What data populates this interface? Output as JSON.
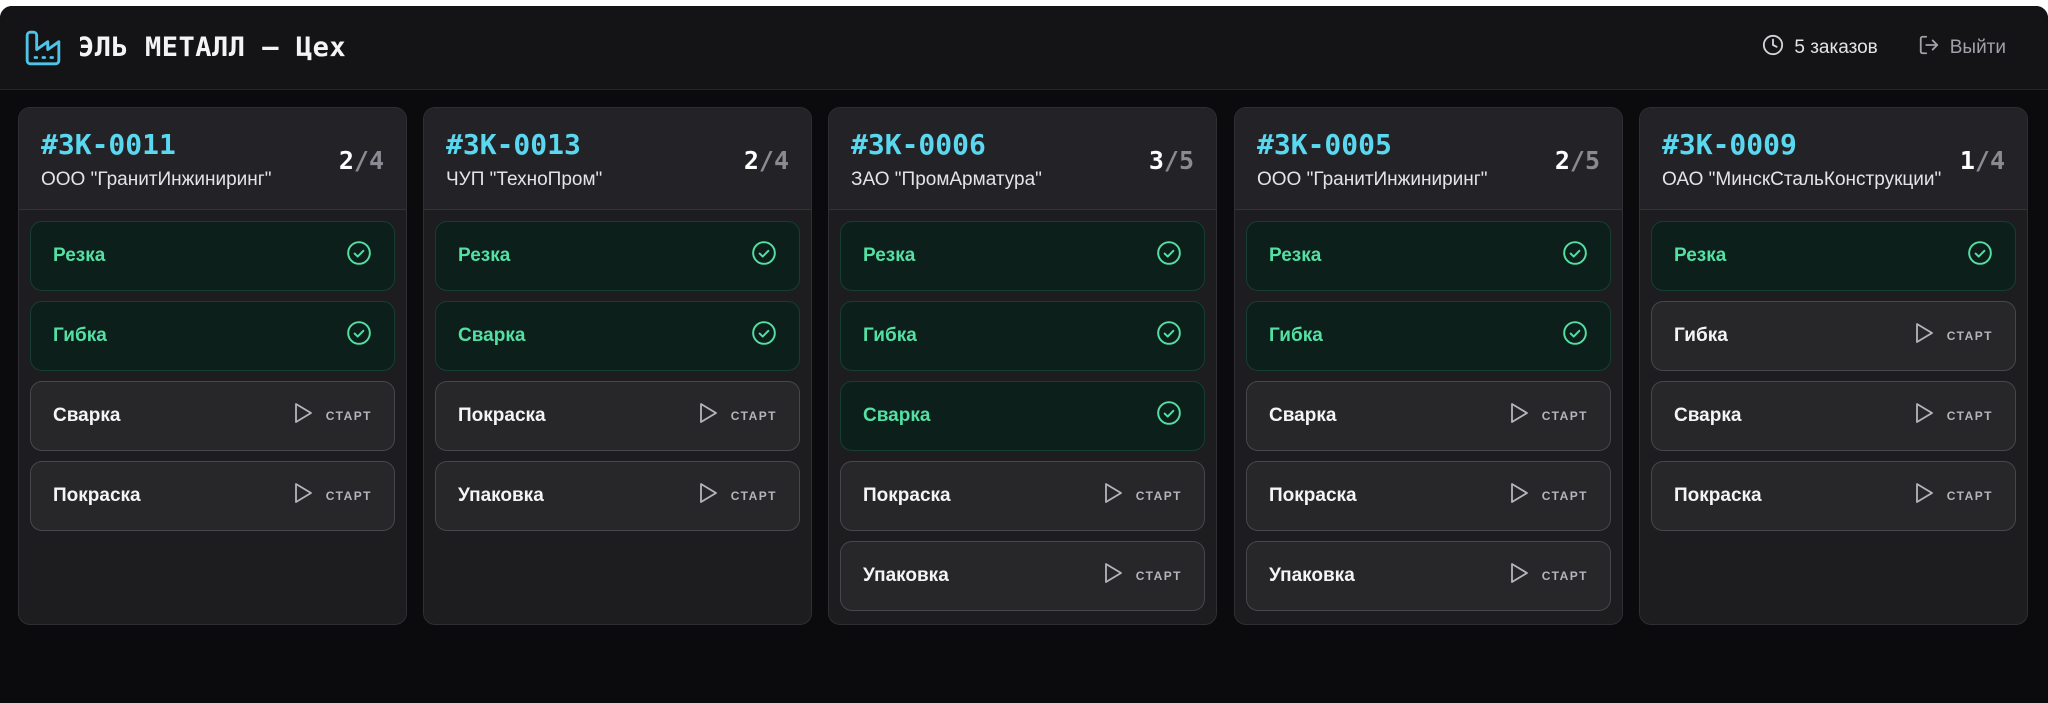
{
  "header": {
    "title": "ЭЛЬ МЕТАЛЛ — Цех",
    "orders_count": "5 заказов",
    "logout": "Выйти"
  },
  "colors": {
    "accent_cyan": "#5ad8f0",
    "done_green": "#54dfa3",
    "background": "#0b0b0d"
  },
  "icons": {
    "brand": "factory-icon",
    "orders": "clock-icon",
    "logout": "logout-icon",
    "done": "check-circle-icon",
    "start": "play-icon"
  },
  "orders": [
    {
      "id": "#ЗК-0011",
      "client": "ООО \"ГранитИнжиниринг\"",
      "done": "2",
      "sep": "/",
      "total": "4",
      "stages": [
        {
          "name": "Резка",
          "status": "done"
        },
        {
          "name": "Гибка",
          "status": "done"
        },
        {
          "name": "Сварка",
          "status": "todo",
          "action": "СТАРТ"
        },
        {
          "name": "Покраска",
          "status": "todo",
          "action": "СТАРТ"
        }
      ]
    },
    {
      "id": "#ЗК-0013",
      "client": "ЧУП \"ТехноПром\"",
      "done": "2",
      "sep": "/",
      "total": "4",
      "stages": [
        {
          "name": "Резка",
          "status": "done"
        },
        {
          "name": "Сварка",
          "status": "done"
        },
        {
          "name": "Покраска",
          "status": "todo",
          "action": "СТАРТ"
        },
        {
          "name": "Упаковка",
          "status": "todo",
          "action": "СТАРТ"
        }
      ]
    },
    {
      "id": "#ЗК-0006",
      "client": "ЗАО \"ПромАрматура\"",
      "done": "3",
      "sep": "/",
      "total": "5",
      "stages": [
        {
          "name": "Резка",
          "status": "done"
        },
        {
          "name": "Гибка",
          "status": "done"
        },
        {
          "name": "Сварка",
          "status": "done"
        },
        {
          "name": "Покраска",
          "status": "todo",
          "action": "СТАРТ"
        },
        {
          "name": "Упаковка",
          "status": "todo",
          "action": "СТАРТ"
        }
      ]
    },
    {
      "id": "#ЗК-0005",
      "client": "ООО \"ГранитИнжиниринг\"",
      "done": "2",
      "sep": "/",
      "total": "5",
      "stages": [
        {
          "name": "Резка",
          "status": "done"
        },
        {
          "name": "Гибка",
          "status": "done"
        },
        {
          "name": "Сварка",
          "status": "todo",
          "action": "СТАРТ"
        },
        {
          "name": "Покраска",
          "status": "todo",
          "action": "СТАРТ"
        },
        {
          "name": "Упаковка",
          "status": "todo",
          "action": "СТАРТ"
        }
      ]
    },
    {
      "id": "#ЗК-0009",
      "client": "ОАО \"МинскСтальКонструкции\"",
      "done": "1",
      "sep": "/",
      "total": "4",
      "stages": [
        {
          "name": "Резка",
          "status": "done"
        },
        {
          "name": "Гибка",
          "status": "todo",
          "action": "СТАРТ"
        },
        {
          "name": "Сварка",
          "status": "todo",
          "action": "СТАРТ"
        },
        {
          "name": "Покраска",
          "status": "todo",
          "action": "СТАРТ"
        }
      ]
    }
  ]
}
